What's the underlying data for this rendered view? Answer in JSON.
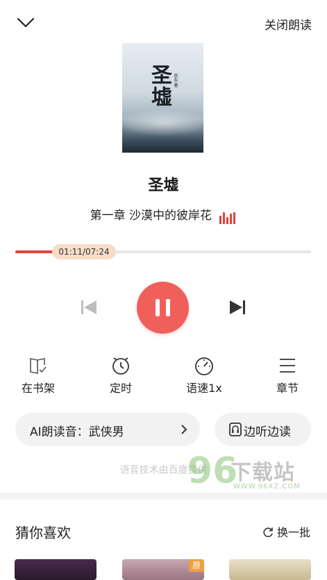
{
  "header": {
    "collapse_icon": "chevron-down-icon",
    "close_reading_label": "关闭朗读"
  },
  "cover": {
    "title_art": "圣墟",
    "side_text": "辰东 著"
  },
  "book": {
    "title": "圣墟",
    "chapter": "第一章 沙漠中的彼岸花"
  },
  "player": {
    "time_label": "01:11/07:24",
    "progress_fraction": 0.16,
    "accent_color": "#e8403a",
    "play_button_color": "#f0605a"
  },
  "tools": [
    {
      "icon": "bookshelf-icon",
      "label": "在书架"
    },
    {
      "icon": "alarm-clock-icon",
      "label": "定时"
    },
    {
      "icon": "speedometer-icon",
      "label": "语速1x"
    },
    {
      "icon": "menu-lines-icon",
      "label": "章节"
    }
  ],
  "voice": {
    "label": "AI朗读音：武侠男"
  },
  "listen_read": {
    "label": "边听边读"
  },
  "tech_credit": "语音技术由百度提供",
  "watermark": {
    "number": "96",
    "text": "下载站",
    "url": "WWW.96XZ.COM"
  },
  "recommend": {
    "title": "猜你喜欢",
    "refresh_label": "换一批",
    "badge": "原"
  }
}
